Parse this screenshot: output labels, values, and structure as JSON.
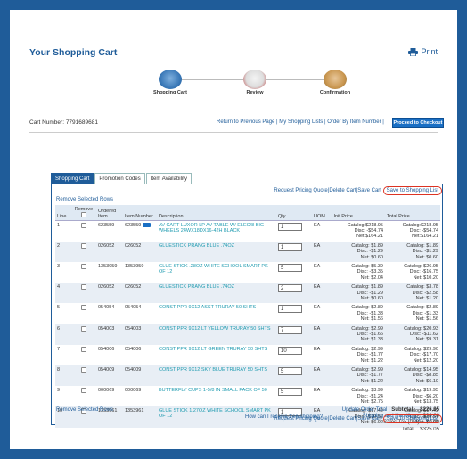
{
  "page": {
    "title": "Your Shopping Cart",
    "print_label": "Print"
  },
  "steps": [
    {
      "label": "Shopping Cart"
    },
    {
      "label": "Review"
    },
    {
      "label": "Confirmation"
    }
  ],
  "cart": {
    "number_label": "Cart Number: 7791689681"
  },
  "toplinks": {
    "return": "Return to Previous Page",
    "lists": "My Shopping Lists",
    "order_by": "Order By Item Number",
    "sep": " | ",
    "checkout": "Proceed to Checkout"
  },
  "tabs": [
    "Shopping Cart",
    "Promotion Codes",
    "Item Availability"
  ],
  "actions": {
    "quote": "Request Pricing Quote",
    "delete": "Delete Cart",
    "save_cart": "Save Cart",
    "save_list": "Save to Shopping List",
    "sep": " | "
  },
  "remove_rows": "Remove Selected Rows",
  "columns": {
    "line": "Line",
    "remove": "Remove",
    "ordered": "Ordered Item",
    "item": "Item Number",
    "desc": "Description",
    "qty": "Qty",
    "uom": "UOM",
    "unit": "Unit Price",
    "total": "Total Price"
  },
  "rows": [
    {
      "line": "1",
      "ordered": "623559",
      "item": "623559",
      "desc": "AV CART LUXOR LP AV TABLE W/ ELEC/8 BIG WHEELS 24WX18DX16-42H BLACK",
      "qty": "1",
      "uom": "EA",
      "u1": "Catalog:$218.95",
      "u2": "Disc: -$54.74",
      "u3": "Net:$164.21",
      "t1": "Catalog:$218.95",
      "t2": "Disc: -$54.74",
      "t3": "Net:$164.21"
    },
    {
      "line": "2",
      "ordered": "026052",
      "item": "026052",
      "desc": "GLUESTICK PRANG BLUE .74OZ",
      "qty": "1",
      "uom": "EA",
      "u1": "Catalog: $1.89",
      "u2": "Disc: -$1.29",
      "u3": "Net: $0.60",
      "t1": "Catalog: $1.89",
      "t2": "Disc: -$1.29",
      "t3": "Net: $0.60"
    },
    {
      "line": "3",
      "ordered": "1353959",
      "item": "1353959",
      "desc": "GLUE STICK .28OZ WHITE SCHOOL SMART PK OF 12",
      "qty": "5",
      "uom": "EA",
      "u1": "Catalog: $5.39",
      "u2": "Disc: -$3.35",
      "u3": "Net: $2.04",
      "t1": "Catalog: $26.95",
      "t2": "Disc: -$16.75",
      "t3": "Net: $10.20"
    },
    {
      "line": "4",
      "ordered": "026052",
      "item": "026052",
      "desc": "GLUESTICK PRANG BLUE .74OZ",
      "qty": "2",
      "uom": "EA",
      "u1": "Catalog: $1.89",
      "u2": "Disc: -$1.29",
      "u3": "Net: $0.60",
      "t1": "Catalog: $3.78",
      "t2": "Disc: -$2.58",
      "t3": "Net: $1.20"
    },
    {
      "line": "5",
      "ordered": "054054",
      "item": "054054",
      "desc": "CONST PPR 9X12 ASST TRURAY 50 SHTS",
      "qty": "1",
      "uom": "EA",
      "u1": "Catalog: $2.89",
      "u2": "Disc: -$1.33",
      "u3": "Net: $1.56",
      "t1": "Catalog: $2.89",
      "t2": "Disc: -$1.33",
      "t3": "Net: $1.56"
    },
    {
      "line": "6",
      "ordered": "054003",
      "item": "054003",
      "desc": "CONST PPR 9X12 LT YELLOW TRURAY 50 SHTS",
      "qty": "7",
      "uom": "EA",
      "u1": "Catalog: $2.99",
      "u2": "Disc: -$1.66",
      "u3": "Net: $1.33",
      "t1": "Catalog: $20.93",
      "t2": "Disc: -$11.62",
      "t3": "Net: $9.31"
    },
    {
      "line": "7",
      "ordered": "054006",
      "item": "054006",
      "desc": "CONST PPR 9X12 LT GREEN TRURAY 50 SHTS",
      "qty": "10",
      "uom": "EA",
      "u1": "Catalog: $2.99",
      "u2": "Disc: -$1.77",
      "u3": "Net: $1.22",
      "t1": "Catalog: $29.90",
      "t2": "Disc: -$17.70",
      "t3": "Net: $12.20"
    },
    {
      "line": "8",
      "ordered": "054009",
      "item": "054009",
      "desc": "CONST PPR 9X12 SKY BLUE TRURAY 50 SHTS",
      "qty": "5",
      "uom": "EA",
      "u1": "Catalog: $2.99",
      "u2": "Disc: -$1.77",
      "u3": "Net: $1.22",
      "t1": "Catalog: $14.95",
      "t2": "Disc: -$8.85",
      "t3": "Net: $6.10"
    },
    {
      "line": "9",
      "ordered": "000069",
      "item": "000069",
      "desc": "BUTTERFLY CUPS 1-5/8 IN SMALL PACK OF 50",
      "qty": "5",
      "uom": "EA",
      "u1": "Catalog: $3.99",
      "u2": "Disc: -$1.24",
      "u3": "Net: $2.75",
      "t1": "Catalog: $19.95",
      "t2": "Disc: -$6.20",
      "t3": "Net: $13.75"
    },
    {
      "line": "10",
      "ordered": "1353961",
      "item": "1353961",
      "desc": "GLUE STICK 1.27OZ WHITE SCHOOL SMART PK OF 12",
      "qty": "1",
      "uom": "EA",
      "u1": "Catalog: $17.49",
      "u2": "Disc: -$10.57",
      "u3": "Net: $6.92",
      "t1": "Catalog: $17.49",
      "t2": "Disc: -$10.57",
      "t3": "Net: $6.92"
    }
  ],
  "footer": {
    "remove": "Remove Selected Rows",
    "free_ship": "How can I receive free shipping?",
    "update": "Update Order Total",
    "sep": " | ",
    "subtotal_label": "Subtotal:",
    "subtotal": "$226.05",
    "shipping_label": "Shipping and Handling:",
    "shipping": "$99.00",
    "tax_label": "Sales Tax (0%):",
    "tax": "$0.00",
    "total_label": "Total:",
    "total": "$325.05"
  },
  "colors": {
    "brand": "#1f5c99",
    "highlight": "#dd3322",
    "checkout": "#1a6fc4",
    "link": "#1f9bb0"
  }
}
